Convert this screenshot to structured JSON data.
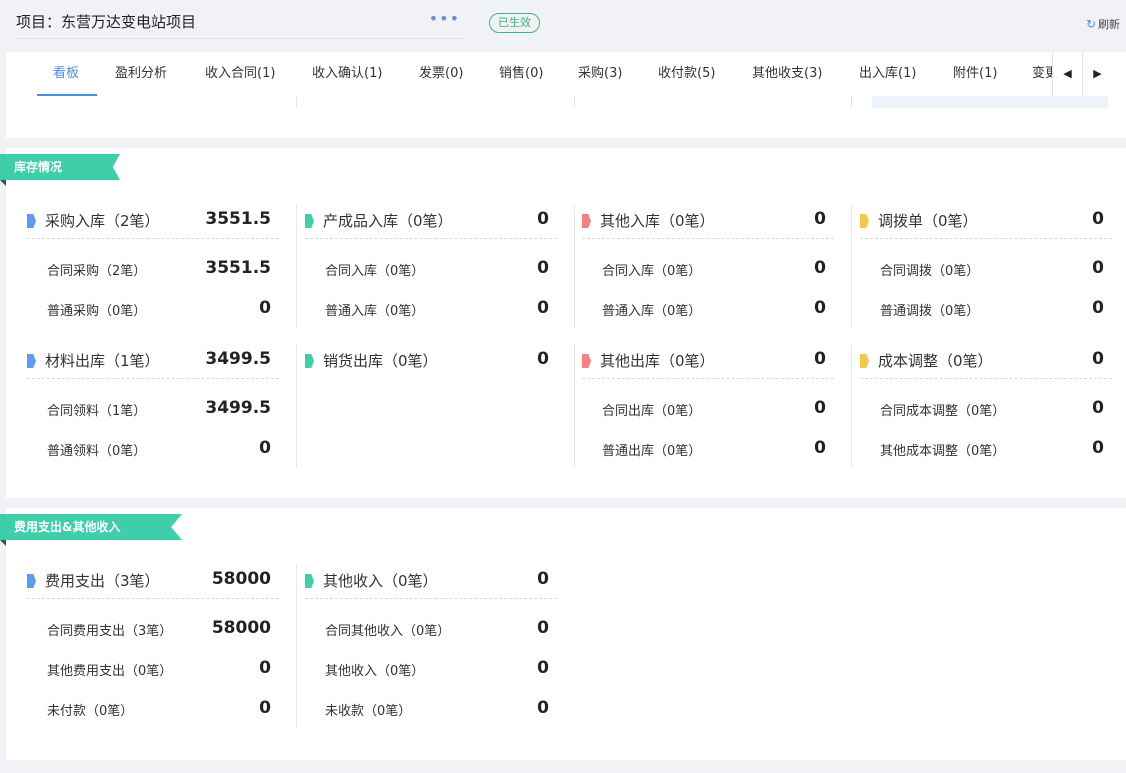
{
  "header": {
    "project_label": "项目：东营万达变电站项目",
    "more_symbol": "•••",
    "status": "已生效",
    "refresh_label": "刷新",
    "refresh_icon": "↻"
  },
  "tabs": {
    "items": [
      "看板",
      "盈利分析",
      "收入合同(1)",
      "收入确认(1)",
      "发票(0)",
      "销售(0)",
      "采购(3)",
      "收付款(5)",
      "其他收支(3)",
      "出入库(1)",
      "附件(1)",
      "变更"
    ],
    "prev_icon": "◀",
    "next_icon": "▶"
  },
  "colors": {
    "blue": "#5b9cf0",
    "teal": "#3ecfaa",
    "red": "#f2817f",
    "yellow": "#f5c84c"
  },
  "inventory": {
    "title": "库存情况",
    "cards": [
      {
        "label": "采购入库（2笔）",
        "value": "3551.5",
        "rows": [
          {
            "label": "合同采购（2笔）",
            "value": "3551.5"
          },
          {
            "label": "普通采购（0笔）",
            "value": "0"
          }
        ]
      },
      {
        "label": "产成品入库（0笔）",
        "value": "0",
        "rows": [
          {
            "label": "合同入库（0笔）",
            "value": "0"
          },
          {
            "label": "普通入库（0笔）",
            "value": "0"
          }
        ]
      },
      {
        "label": "其他入库（0笔）",
        "value": "0",
        "rows": [
          {
            "label": "合同入库（0笔）",
            "value": "0"
          },
          {
            "label": "普通入库（0笔）",
            "value": "0"
          }
        ]
      },
      {
        "label": "调拨单（0笔）",
        "value": "0",
        "rows": [
          {
            "label": "合同调拨（0笔）",
            "value": "0"
          },
          {
            "label": "普通调拨（0笔）",
            "value": "0"
          }
        ]
      },
      {
        "label": "材料出库（1笔）",
        "value": "3499.5",
        "rows": [
          {
            "label": "合同领料（1笔）",
            "value": "3499.5"
          },
          {
            "label": "普通领料（0笔）",
            "value": "0"
          }
        ]
      },
      {
        "label": "销货出库（0笔）",
        "value": "0",
        "rows": []
      },
      {
        "label": "其他出库（0笔）",
        "value": "0",
        "rows": [
          {
            "label": "合同出库（0笔）",
            "value": "0"
          },
          {
            "label": "普通出库（0笔）",
            "value": "0"
          }
        ]
      },
      {
        "label": "成本调整（0笔）",
        "value": "0",
        "rows": [
          {
            "label": "合同成本调整（0笔）",
            "value": "0"
          },
          {
            "label": "其他成本调整（0笔）",
            "value": "0"
          }
        ]
      }
    ]
  },
  "expense": {
    "title": "费用支出&其他收入",
    "cards": [
      {
        "label": "费用支出（3笔）",
        "value": "58000",
        "rows": [
          {
            "label": "合同费用支出（3笔）",
            "value": "58000"
          },
          {
            "label": "其他费用支出（0笔）",
            "value": "0"
          },
          {
            "label": "未付款（0笔）",
            "value": "0"
          }
        ]
      },
      {
        "label": "其他收入（0笔）",
        "value": "0",
        "rows": [
          {
            "label": "合同其他收入（0笔）",
            "value": "0"
          },
          {
            "label": "其他收入（0笔）",
            "value": "0"
          },
          {
            "label": "未收款（0笔）",
            "value": "0"
          }
        ]
      }
    ]
  }
}
